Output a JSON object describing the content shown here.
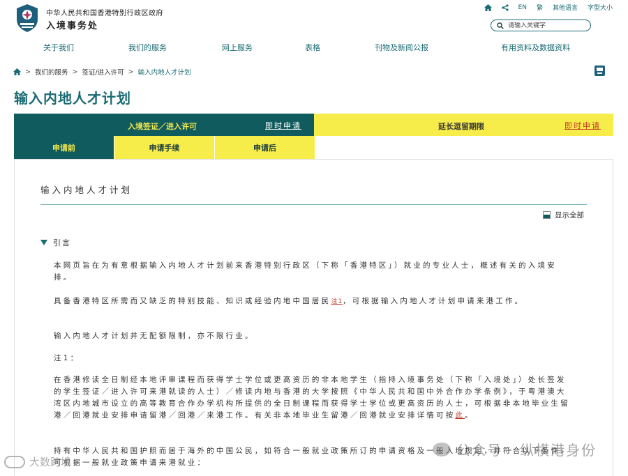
{
  "header": {
    "gov_name": "中华人民共和国香港特别行政区政府",
    "dept_name": "入境事务处",
    "toplinks": [
      "EN",
      "繁",
      "其他语言",
      "字型大小"
    ],
    "search_placeholder": "请输入关键字"
  },
  "nav": [
    "关于我们",
    "我们的服务",
    "网上服务",
    "表格",
    "刊物及新闻公报",
    "有用资料及数据资料"
  ],
  "breadcrumb": [
    "我们的服务",
    "签证/进入许可",
    "输入内地人才计划"
  ],
  "page_title": "输入内地人才计划",
  "tabs": {
    "main_left": "入境签证／进入许可",
    "main_left_apply": "即时申请",
    "main_right": "延长逗留期限",
    "main_right_apply": "即时申请",
    "sub": [
      "申请前",
      "申请手续",
      "申请后"
    ]
  },
  "content": {
    "section_title": "输入内地人才计划",
    "show_all": "显示全部",
    "intro_heading": "引言",
    "p1": "本网页旨在为有意根据输入内地人才计划前来香港特别行政区（下称「香港特区」）就业的专业人士，概述有关的入境安排。",
    "p2_a": "具备香港特区所需而又缺乏的特别技能、知识或经验内地中国居民",
    "p2_note": "注1",
    "p2_b": "，可根据输入内地人才计划申请来港工作。",
    "p3": "输入内地人才计划并无配额限制，亦不限行业。",
    "note_title": "注1：",
    "p4_a": "在香港修读全日制经本地评审课程而获得学士学位或更高资历的非本地学生（指持入境事务处（下称「入境处」）处长签发的学生签证／进入许可来港就读的人士）／修读内地与香港的大学按照《中华人民共和国中外合作办学条例》，于粤港澳大湾区内地城市设立的高等教育合作办学机构所提供的全日制课程而获得学士学位或更高资历的人士，可根据非本地毕业生留港／回港就业安排申请留港／回港／来港工作。有关非本地毕业生留港／回港就业安排详情可按",
    "p4_link": "此",
    "p4_b": "。",
    "p5": "持有中华人民共和国护照而居于海外的中国公民，如符合一般就业政策所订的申请资格及一般入境规定，并符合以下条件，可根据一般就业政策申请来港就业："
  },
  "watermarks": {
    "right": "公众号 · 纵横港身份",
    "left": "大数跨境"
  },
  "colors": {
    "teal": "#0f5b5e",
    "link_teal": "#1a6b74",
    "yellow": "#f7ed4a",
    "red_link": "#c0392b"
  }
}
